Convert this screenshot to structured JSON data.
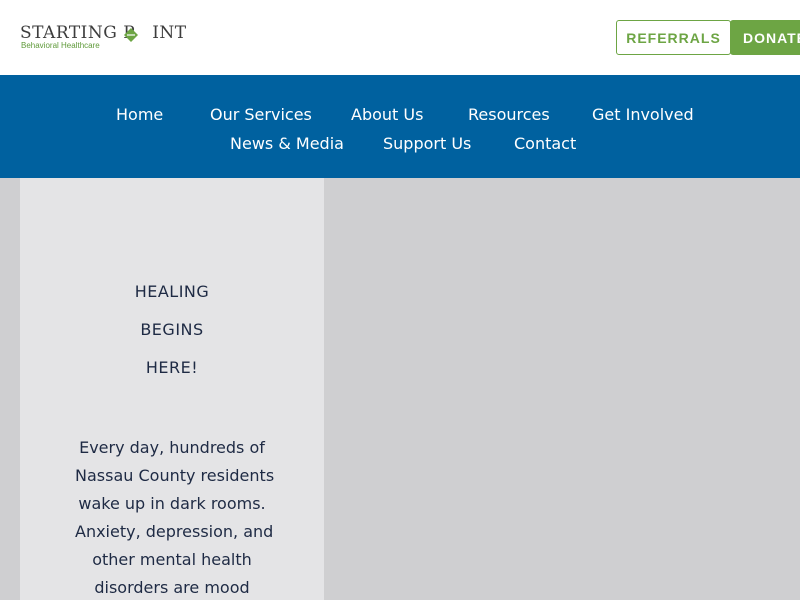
{
  "header": {
    "logo": {
      "name": "STARTING POINT",
      "tagline": "Behavioral Healthcare",
      "icon": "diamond-leaf-icon"
    },
    "referrals_label": "REFERRALS",
    "donate_label": "DONATE"
  },
  "nav": {
    "items": [
      {
        "label": "Home"
      },
      {
        "label": "Our Services"
      },
      {
        "label": "About Us"
      },
      {
        "label": "Resources"
      },
      {
        "label": "Get Involved"
      },
      {
        "label": "News & Media"
      },
      {
        "label": "Support Us"
      },
      {
        "label": "Contact"
      }
    ]
  },
  "hero": {
    "headline_lines": [
      "HEALING",
      "BEGINS",
      "HERE!"
    ],
    "body_lines": [
      "Every day, hundreds of",
      "Nassau County residents",
      "wake up in dark rooms.",
      "Anxiety, depression, and",
      "other mental health",
      "disorders are mood"
    ]
  },
  "colors": {
    "brand_blue": "#00619f",
    "brand_green": "#6da544",
    "text_dark": "#1e2a44",
    "panel_bg": "#e4e4e6",
    "page_bg": "#cfcfd1"
  }
}
